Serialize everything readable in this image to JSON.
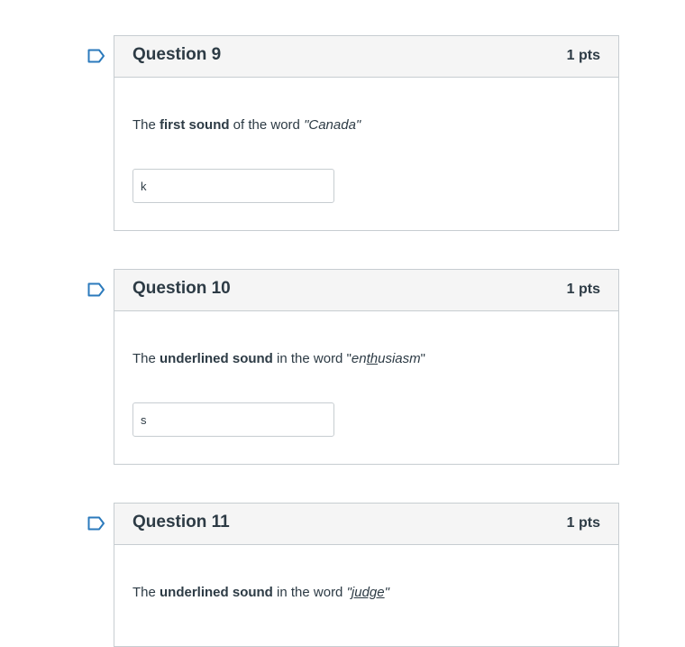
{
  "questions": [
    {
      "title": "Question 9",
      "points": "1 pts",
      "prompt": {
        "pre": "The ",
        "bold": "first sound",
        "mid": " of the word ",
        "word_open": "\"Canada\"",
        "word_underlined": "",
        "word_close": ""
      },
      "answer": "k"
    },
    {
      "title": "Question 10",
      "points": "1 pts",
      "prompt": {
        "pre": "The ",
        "bold": "underlined sound",
        "mid": " in the word \"",
        "word_open": "en",
        "word_underlined": "th",
        "word_close": "usiasm"
      },
      "answer": "s"
    },
    {
      "title": "Question 11",
      "points": "1 pts",
      "prompt": {
        "pre": "The ",
        "bold": "underlined sound",
        "mid": " in the word ",
        "word_open": "\"",
        "word_underlined": "judge",
        "word_close": "\""
      },
      "answer": ""
    }
  ],
  "q10_closing_quote": "\"",
  "colors": {
    "header_bg": "#f5f5f5",
    "border": "#c7cdd1",
    "text": "#2d3b45",
    "flag": "#2b7abc"
  },
  "icons": {
    "flag": "flag-question-icon"
  }
}
